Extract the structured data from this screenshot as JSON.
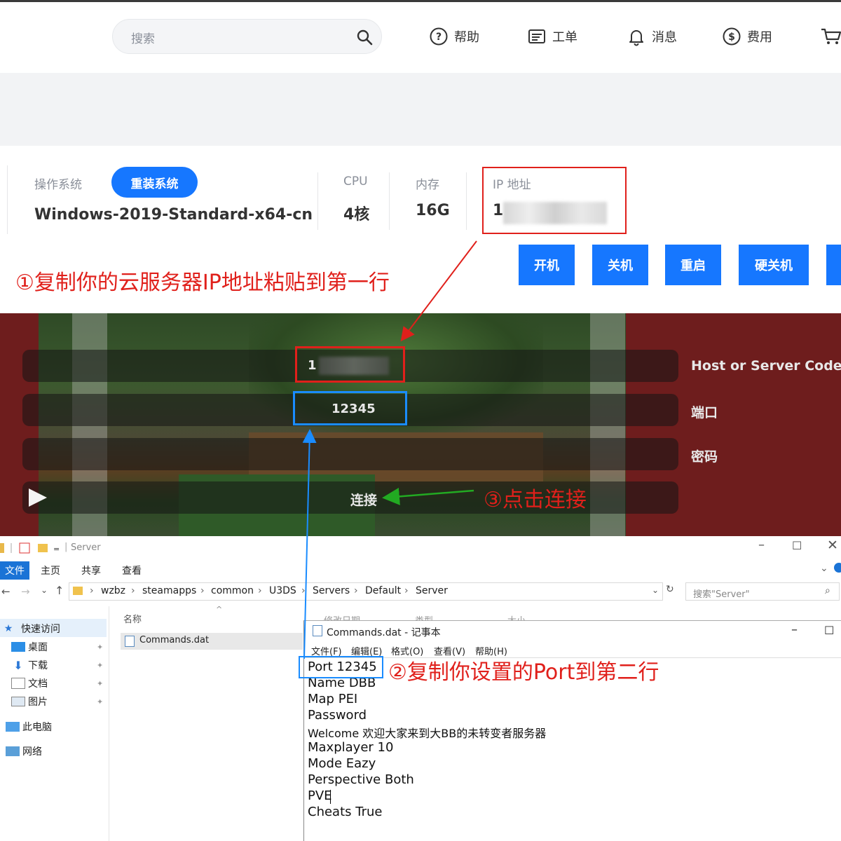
{
  "header": {
    "search_placeholder": "搜索",
    "nav": [
      {
        "label": "帮助",
        "icon": "question-circle-icon"
      },
      {
        "label": "工单",
        "icon": "ticket-icon"
      },
      {
        "label": "消息",
        "icon": "bell-icon"
      },
      {
        "label": "费用",
        "icon": "dollar-circle-icon"
      }
    ],
    "cart_icon": "cart-icon"
  },
  "instance": {
    "os_label": "操作系统",
    "reinstall_label": "重装系统",
    "os_value": "Windows-2019-Standard-x64-cn",
    "cpu_label": "CPU",
    "cpu_value": "4核",
    "mem_label": "内存",
    "mem_value": "16G",
    "ip_label": "IP 地址",
    "ip_value_visible": "1",
    "actions": [
      "开机",
      "关机",
      "重启",
      "硬关机"
    ]
  },
  "annotations": {
    "step1": "①复制你的云服务器IP地址粘贴到第一行",
    "step2": "②复制你设置的Port到第二行",
    "step3": "③点击连接"
  },
  "game": {
    "host_field_value": "1",
    "port_field_value": "12345",
    "host_label": "Host or Server Code",
    "port_label": "端口",
    "password_label": "密码",
    "connect_label": "连接",
    "play_icon": "play-icon"
  },
  "explorer": {
    "title": "Server",
    "tabs": [
      "文件",
      "主页",
      "共享",
      "查看"
    ],
    "breadcrumb": [
      "wzbz",
      "steamapps",
      "common",
      "U3DS",
      "Servers",
      "Default",
      "Server"
    ],
    "search_placeholder": "搜索\"Server\"",
    "sidebar": [
      {
        "label": "快速访问",
        "icon": "star-icon"
      },
      {
        "label": "桌面",
        "icon": "desktop-icon"
      },
      {
        "label": "下载",
        "icon": "download-icon"
      },
      {
        "label": "文档",
        "icon": "document-icon"
      },
      {
        "label": "图片",
        "icon": "picture-icon"
      },
      {
        "label": "此电脑",
        "icon": "computer-icon"
      },
      {
        "label": "网络",
        "icon": "network-icon"
      }
    ],
    "columns": [
      "名称",
      "修改日期",
      "类型",
      "大小"
    ],
    "files": [
      "Commands.dat"
    ]
  },
  "notepad": {
    "title": "Commands.dat - 记事本",
    "menu": [
      "文件(F)",
      "编辑(E)",
      "格式(O)",
      "查看(V)",
      "帮助(H)"
    ],
    "lines": [
      "Port 12345",
      "Name DBB",
      "Map PEI",
      "Password",
      "Welcome 欢迎大家来到大BB的未转变者服务器",
      "Maxplayer 10",
      "Mode Eazy",
      "Perspective Both",
      "PVE",
      "Cheats True"
    ]
  },
  "colors": {
    "accent": "#1677ff",
    "highlight_red": "#e0201b",
    "highlight_blue": "#1a8cff",
    "arrow_green": "#22aa22",
    "game_bg": "#6e1d1d"
  }
}
